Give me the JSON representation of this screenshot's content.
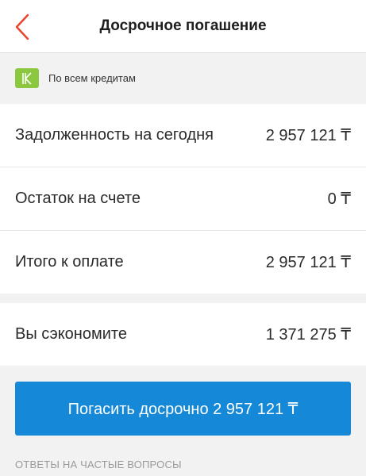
{
  "header": {
    "title": "Досрочное погашение",
    "back_icon": "chevron-left-icon",
    "accent_color": "#e8442e"
  },
  "filter": {
    "badge_letter": "К",
    "badge_color": "#8bc83f",
    "label": "По всем кредитам"
  },
  "rows": [
    {
      "label": "Задолженность на сегодня",
      "value": "2 957 121 ₸"
    },
    {
      "label": "Остаток на счете",
      "value": "0 ₸"
    },
    {
      "label": "Итого к оплате",
      "value": "2 957 121 ₸"
    },
    {
      "label": "Вы сэкономите",
      "value": "1 371 275 ₸"
    }
  ],
  "action": {
    "pay_button_label": "Погасить досрочно 2 957 121 ₸",
    "button_color": "#1588d8"
  },
  "faq": {
    "label": "ОТВЕТЫ НА ЧАСТЫЕ ВОПРОСЫ"
  }
}
